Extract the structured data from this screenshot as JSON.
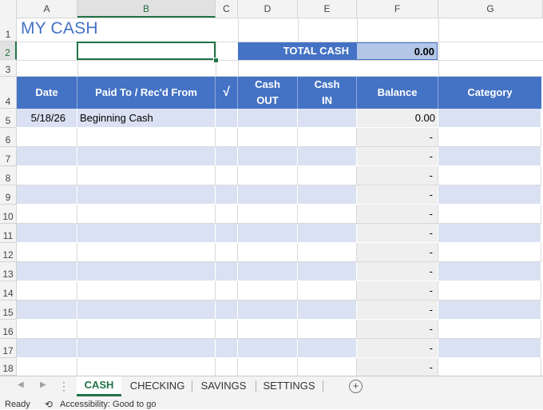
{
  "columns": [
    "A",
    "B",
    "C",
    "D",
    "E",
    "F",
    "G"
  ],
  "rows": [
    "1",
    "2",
    "3",
    "4",
    "5",
    "6",
    "7",
    "8",
    "9",
    "10",
    "11",
    "12",
    "13",
    "14",
    "15",
    "16",
    "17",
    "18"
  ],
  "title": "MY CASH",
  "total": {
    "label": "TOTAL CASH",
    "value": "0.00"
  },
  "headers": {
    "date": "Date",
    "paid_to": "Paid To / Rec'd From",
    "check": "√",
    "cash_out_1": "Cash",
    "cash_out_2": "OUT",
    "cash_in_1": "Cash",
    "cash_in_2": "IN",
    "balance": "Balance",
    "category": "Category"
  },
  "first_row": {
    "date": "5/18/26",
    "paid_to": "Beginning Cash",
    "balance": "0.00"
  },
  "empty_balance": "-",
  "tabs": {
    "cash": "CASH",
    "checking": "CHECKING",
    "savings": "SAVINGS",
    "settings": "SETTINGS",
    "add": "+"
  },
  "status": {
    "ready": "Ready",
    "accessibility": "Accessibility: Good to go"
  },
  "colors": {
    "header_blue": "#4472c4",
    "band_blue": "#d9e1f2",
    "balance_gray": "#efefef",
    "excel_green": "#217346"
  }
}
